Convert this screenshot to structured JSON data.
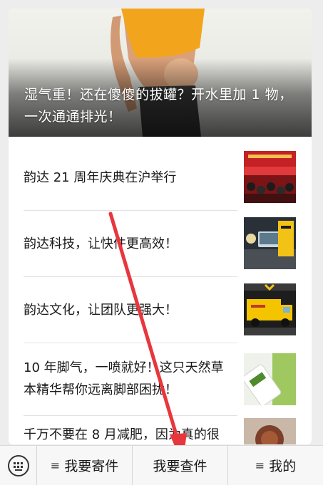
{
  "hero": {
    "title": "湿气重！还在傻傻的拔罐？开水里加 1 物，一次通通排光！"
  },
  "articles": [
    {
      "title": "韵达 21 周年庆典在沪举行",
      "thumb_icon": "event-stage-photo"
    },
    {
      "title": "韵达科技，让快件更高效！",
      "thumb_icon": "tech-device-photo"
    },
    {
      "title": "韵达文化，让团队更强大！",
      "thumb_icon": "delivery-truck-photo"
    },
    {
      "title": "10 年脚气，一喷就好！这只天然草本精华帮你远离脚部困扰！",
      "thumb_icon": "product-bottle-photo"
    },
    {
      "title": "千万不要在 8 月减肥，因为真的很",
      "thumb_icon": "food-photo"
    }
  ],
  "bottom_menu": {
    "keyboard_icon": "keyboard-icon",
    "items": [
      {
        "label": "我要寄件",
        "has_submenu": true
      },
      {
        "label": "我要查件",
        "has_submenu": false
      },
      {
        "label": "我的",
        "has_submenu": true
      }
    ]
  },
  "colors": {
    "accent_arrow": "#e8363d",
    "page_bg": "#ededed",
    "text": "#191919"
  }
}
